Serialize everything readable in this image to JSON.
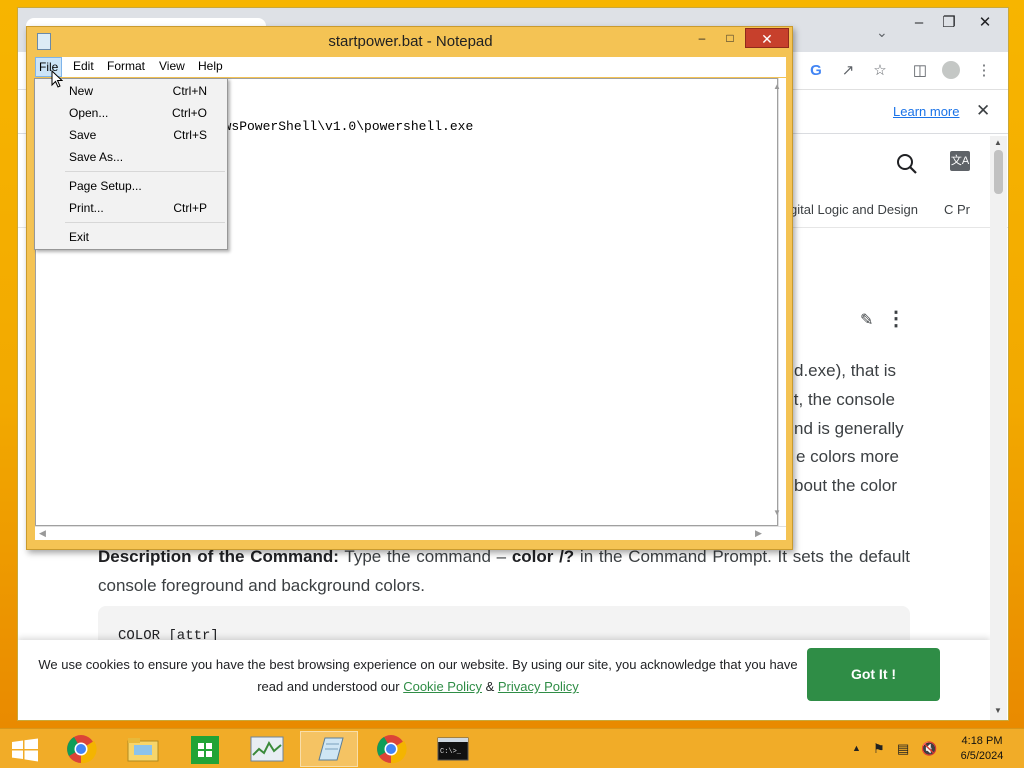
{
  "browser": {
    "infobar": {
      "learn_more": "Learn more"
    },
    "nav": [
      "gital Logic and Design",
      "C Pr"
    ],
    "paragraph_fragments": [
      "d.exe),  that  is",
      "lt, the console",
      "nd is generally",
      "e  colors  more",
      "bout the color"
    ],
    "description": {
      "label": "Description of the Command:",
      "text_a": " Type the command – ",
      "command": "color /?",
      "text_b": " in the Command Prompt. It sets the default console foreground and background colors."
    },
    "code": "COLOR [attr]",
    "cookie": {
      "text_a": "We use cookies to ensure you have the best browsing experience on our website. By using our site, you acknowledge that you have read and understood our ",
      "cookie_policy": "Cookie Policy",
      "amp": " & ",
      "privacy_policy": "Privacy Policy",
      "button": "Got It !"
    },
    "translate_glyph": "文A",
    "google_letter": "G"
  },
  "notepad": {
    "title": "startpower.bat - Notepad",
    "menu": [
      "File",
      "Edit",
      "Format",
      "View",
      "Help"
    ],
    "content": "dowsPowerShell\\v1.0\\powershell.exe",
    "file_menu": [
      {
        "label": "New",
        "shortcut": "Ctrl+N"
      },
      {
        "label": "Open...",
        "shortcut": "Ctrl+O"
      },
      {
        "label": "Save",
        "shortcut": "Ctrl+S"
      },
      {
        "label": "Save As...",
        "shortcut": ""
      },
      {
        "label": "Page Setup...",
        "shortcut": ""
      },
      {
        "label": "Print...",
        "shortcut": "Ctrl+P"
      },
      {
        "label": "Exit",
        "shortcut": ""
      }
    ]
  },
  "taskbar": {
    "time": "4:18 PM",
    "date": "6/5/2024",
    "apps": [
      "chrome",
      "file-explorer",
      "store",
      "task-manager",
      "notepad",
      "chrome",
      "command-prompt"
    ],
    "active_app": "notepad",
    "cmd_glyph": "C:\\>_"
  },
  "colors": {
    "desktop": "#f4b400",
    "taskbar": "#f1ac28",
    "accent_green": "#2f8d46",
    "link_blue": "#1a73e8",
    "close_red": "#c7402c"
  }
}
